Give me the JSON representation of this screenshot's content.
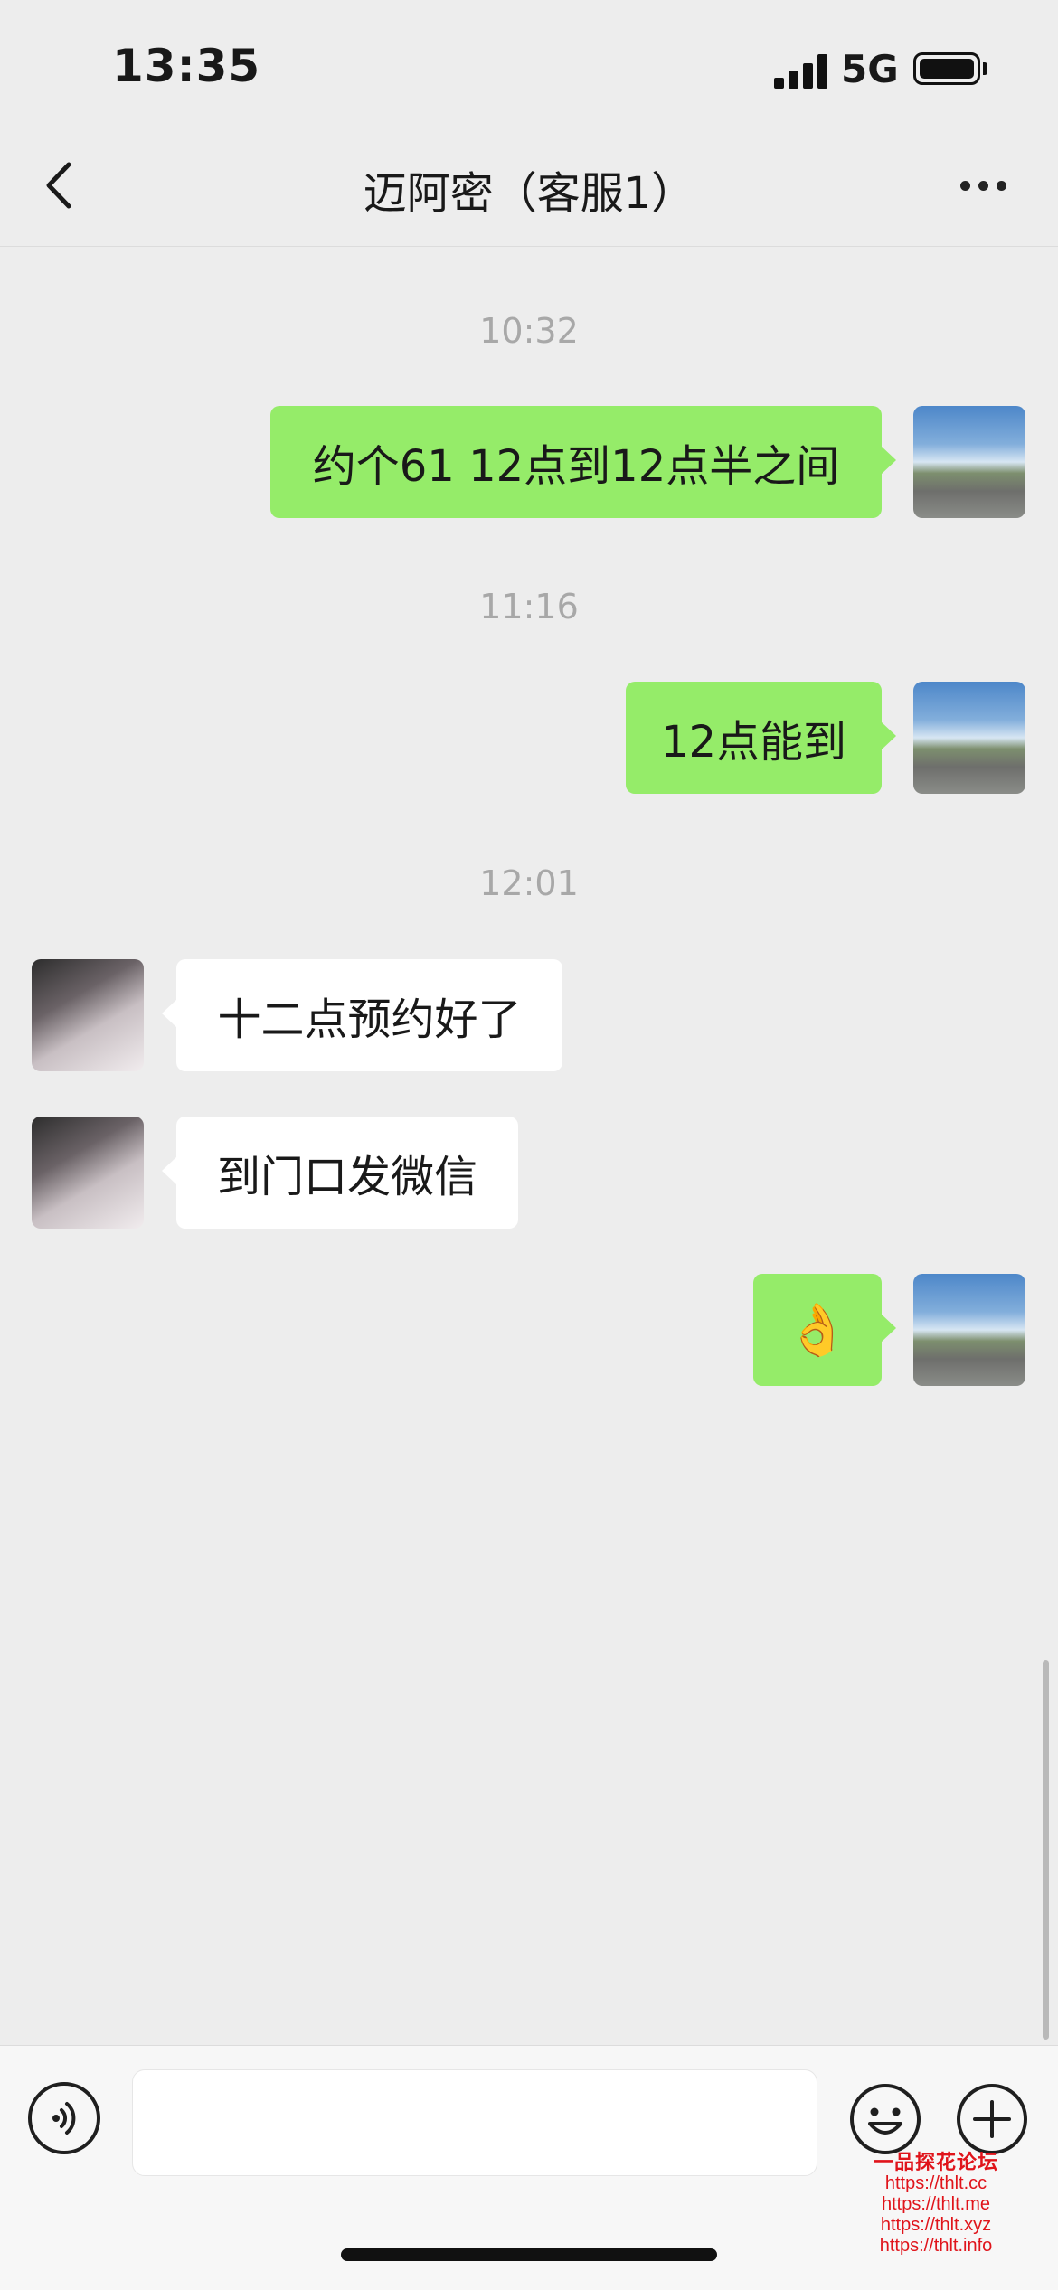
{
  "status_bar": {
    "time": "13:35",
    "network": "5G"
  },
  "header": {
    "title": "迈阿密（客服1）"
  },
  "messages": [
    {
      "type": "timestamp",
      "text": "10:32"
    },
    {
      "type": "sent",
      "text": "约个61 12点到12点半之间"
    },
    {
      "type": "timestamp",
      "text": "11:16"
    },
    {
      "type": "sent",
      "text": "12点能到"
    },
    {
      "type": "timestamp",
      "text": "12:01"
    },
    {
      "type": "received",
      "text": "十二点预约好了"
    },
    {
      "type": "received",
      "text": "到门口发微信"
    },
    {
      "type": "sent",
      "text": "👌"
    }
  ],
  "input": {
    "value": "",
    "placeholder": ""
  },
  "icons": {
    "back": "chevron-left-icon",
    "more": "more-dots-icon",
    "voice": "voice-icon",
    "emoji": "smiley-icon",
    "plus": "plus-icon"
  },
  "colors": {
    "sent_bubble": "#95ec69",
    "received_bubble": "#ffffff",
    "background": "#ededed"
  },
  "watermark": {
    "title": "一品探花论坛",
    "links": [
      "https://thlt.cc",
      "https://thlt.me",
      "https://thlt.xyz",
      "https://thlt.info"
    ]
  }
}
